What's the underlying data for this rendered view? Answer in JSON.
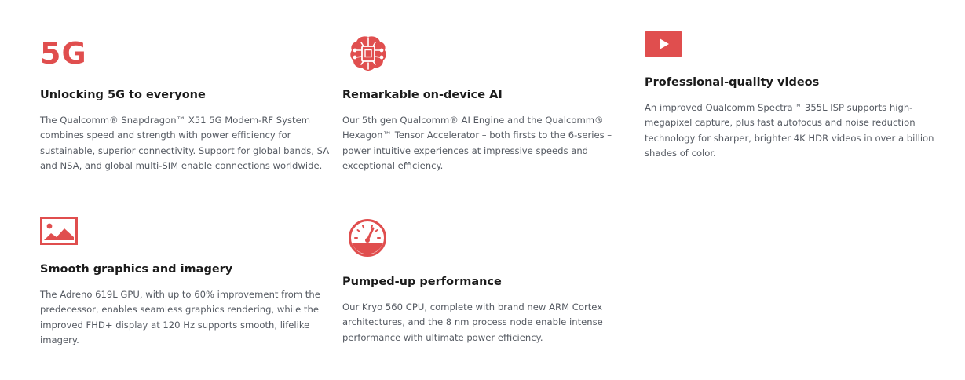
{
  "accent_color": "#e04e4e",
  "features": [
    {
      "icon": "5g-icon",
      "icon_text": "5G",
      "title": "Unlocking 5G to everyone",
      "description_lines": [
        "The Qualcomm® Snapdragon™ X51 5G Modem-RF System",
        "combines speed and strength with power efficiency for",
        "sustainable, superior connectivity. Support for global bands, SA",
        "and NSA, and global multi-SIM enable connections worldwide."
      ]
    },
    {
      "icon": "ai-brain-chip-icon",
      "title": "Remarkable on-device AI",
      "description_lines": [
        "Our 5th gen Qualcomm® AI Engine and the Qualcomm®",
        "Hexagon™ Tensor Accelerator – both firsts to the 6-series –",
        "power intuitive experiences at impressive speeds and",
        "exceptional efficiency."
      ]
    },
    {
      "icon": "video-play-icon",
      "title": "Professional-quality videos",
      "description_lines": [
        "An improved Qualcomm Spectra™ 355L ISP supports high-",
        "megapixel capture, plus fast autofocus and noise reduction",
        "technology for sharper, brighter 4K HDR videos in over a billion",
        "shades of color."
      ]
    },
    {
      "icon": "image-icon",
      "title": "Smooth graphics and imagery",
      "description_lines": [
        "The Adreno 619L GPU, with up to 60% improvement from the",
        "predecessor, enables seamless graphics rendering, while the",
        "improved FHD+ display at 120 Hz supports smooth, lifelike",
        "imagery."
      ]
    },
    {
      "icon": "speedometer-icon",
      "title": "Pumped-up performance",
      "description_lines": [
        "Our Kryo 560 CPU, complete with brand new ARM Cortex",
        "architectures, and the 8 nm process node enable intense",
        "performance with ultimate power efficiency."
      ]
    }
  ]
}
